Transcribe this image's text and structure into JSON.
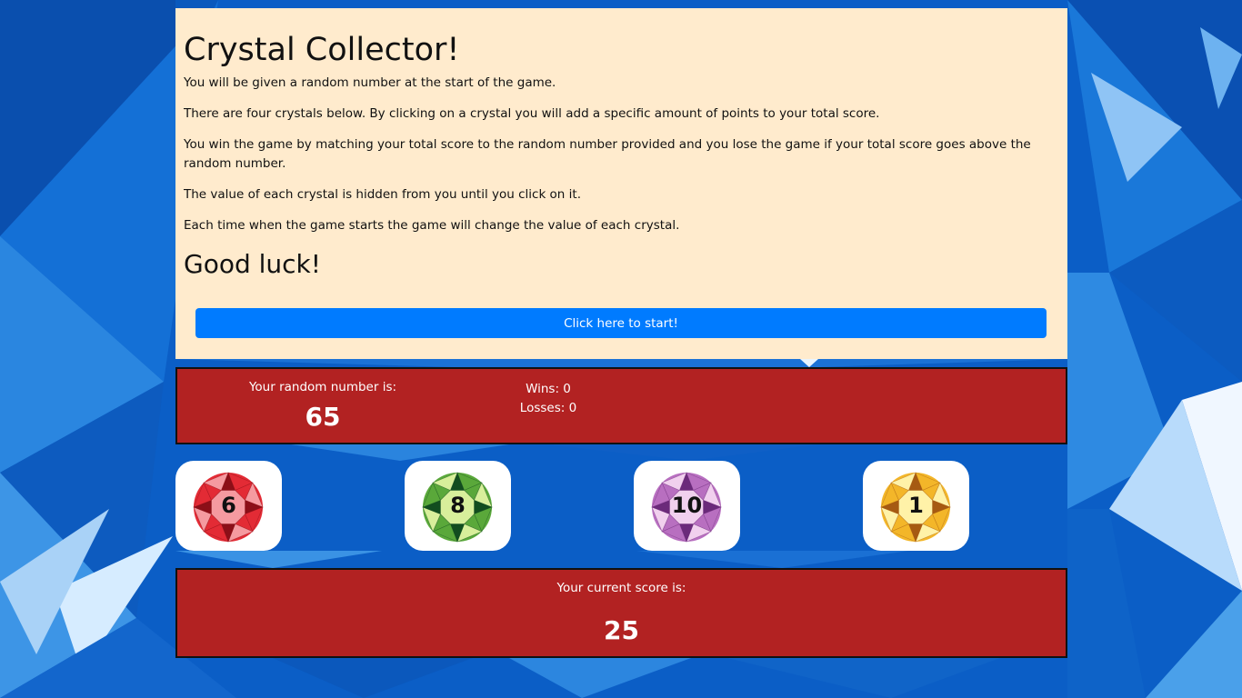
{
  "intro": {
    "title": "Crystal Collector!",
    "paragraphs": [
      "You will be given a random number at the start of the game.",
      "There are four crystals below. By clicking on a crystal you will add a specific amount of points to your total score.",
      "You win the game by matching your total score to the random number provided and you lose the game if your total score goes above the random number.",
      "The value of each crystal is hidden from you until you click on it.",
      "Each time when the game starts the game will change the value of each crystal."
    ],
    "good_luck": "Good luck!",
    "start_button": "Click here to start!"
  },
  "numbers": {
    "random_label": "Your random number is:",
    "random_value": "65",
    "wins": "Wins: 0",
    "losses": "Losses: 0"
  },
  "crystals": [
    {
      "value": "6",
      "color": "red",
      "outer": "#e32b35",
      "light": "#f59aa0",
      "dark": "#8c0f18"
    },
    {
      "value": "8",
      "color": "green",
      "outer": "#5aa83a",
      "light": "#d8ef9b",
      "dark": "#124d1f"
    },
    {
      "value": "10",
      "color": "purple",
      "outer": "#b86fc0",
      "light": "#f1d0ee",
      "dark": "#6b2a7a"
    },
    {
      "value": "1",
      "color": "yellow",
      "outer": "#f3b629",
      "light": "#fff2a8",
      "dark": "#a65a12"
    }
  ],
  "score": {
    "label": "Your current score is:",
    "value": "25"
  }
}
